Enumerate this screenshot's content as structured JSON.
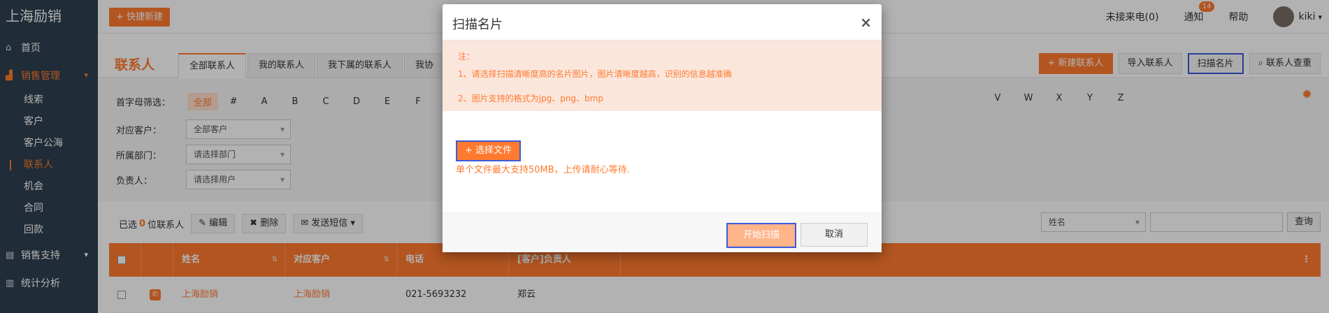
{
  "sidebar": {
    "brand": "上海励销",
    "items": [
      {
        "label": "首页",
        "icon": "home-icon"
      },
      {
        "label": "销售管理",
        "icon": "chart-icon"
      },
      {
        "label": "销售支持",
        "icon": "document-icon"
      },
      {
        "label": "统计分析",
        "icon": "bar-chart-icon"
      }
    ],
    "sub_items": [
      "线索",
      "客户",
      "客户公海",
      "联系人",
      "机会",
      "合同",
      "回款"
    ]
  },
  "topbar": {
    "quick_new": "+ 快捷新建",
    "missed_calls": "未接来电(0)",
    "notifications": "通知",
    "notif_count": "14",
    "help": "帮助",
    "user": "kiki"
  },
  "page": {
    "title": "联系人",
    "tabs": [
      "全部联系人",
      "我的联系人",
      "我下属的联系人",
      "我协"
    ],
    "buttons": {
      "new_contact": "+ 新建联系人",
      "import": "导入联系人",
      "scan": "扫描名片",
      "dedupe": "联系人查重"
    }
  },
  "filters": {
    "letter_label": "首字母筛选：",
    "letters_left": [
      "全部",
      "#",
      "A",
      "B",
      "C",
      "D",
      "E",
      "F"
    ],
    "letters_right": [
      "V",
      "W",
      "X",
      "Y",
      "Z"
    ],
    "rows": [
      {
        "label": "对应客户：",
        "value": "全部客户"
      },
      {
        "label": "所属部门：",
        "value": "请选择部门"
      },
      {
        "label": "负责人：",
        "value": "请选择用户"
      }
    ]
  },
  "toolbar": {
    "selected_prefix": "已选",
    "selected_count": "0",
    "selected_suffix": "位联系人",
    "edit": "编辑",
    "delete": "删除",
    "sms": "发送短信",
    "search_field": "姓名",
    "query": "查询"
  },
  "table": {
    "headers": [
      "姓名",
      "对应客户",
      "电话",
      "[客户]负责人"
    ],
    "rows": [
      {
        "name": "上海励销",
        "customer": "上海励销",
        "phone": "021-5693232",
        "owner": "郑云"
      }
    ]
  },
  "modal": {
    "title": "扫描名片",
    "close": "×",
    "note_title": "注：",
    "note1": "1、请选择扫描清晰度高的名片图片，图片清晰度越高，识别的信息越准确",
    "note2": "2、图片支持的格式为jpg、png、bmp",
    "choose_file": "+ 选择文件",
    "upload_hint": "单个文件最大支持50MB，上传请耐心等待.",
    "start": "开始扫描",
    "cancel": "取消"
  }
}
